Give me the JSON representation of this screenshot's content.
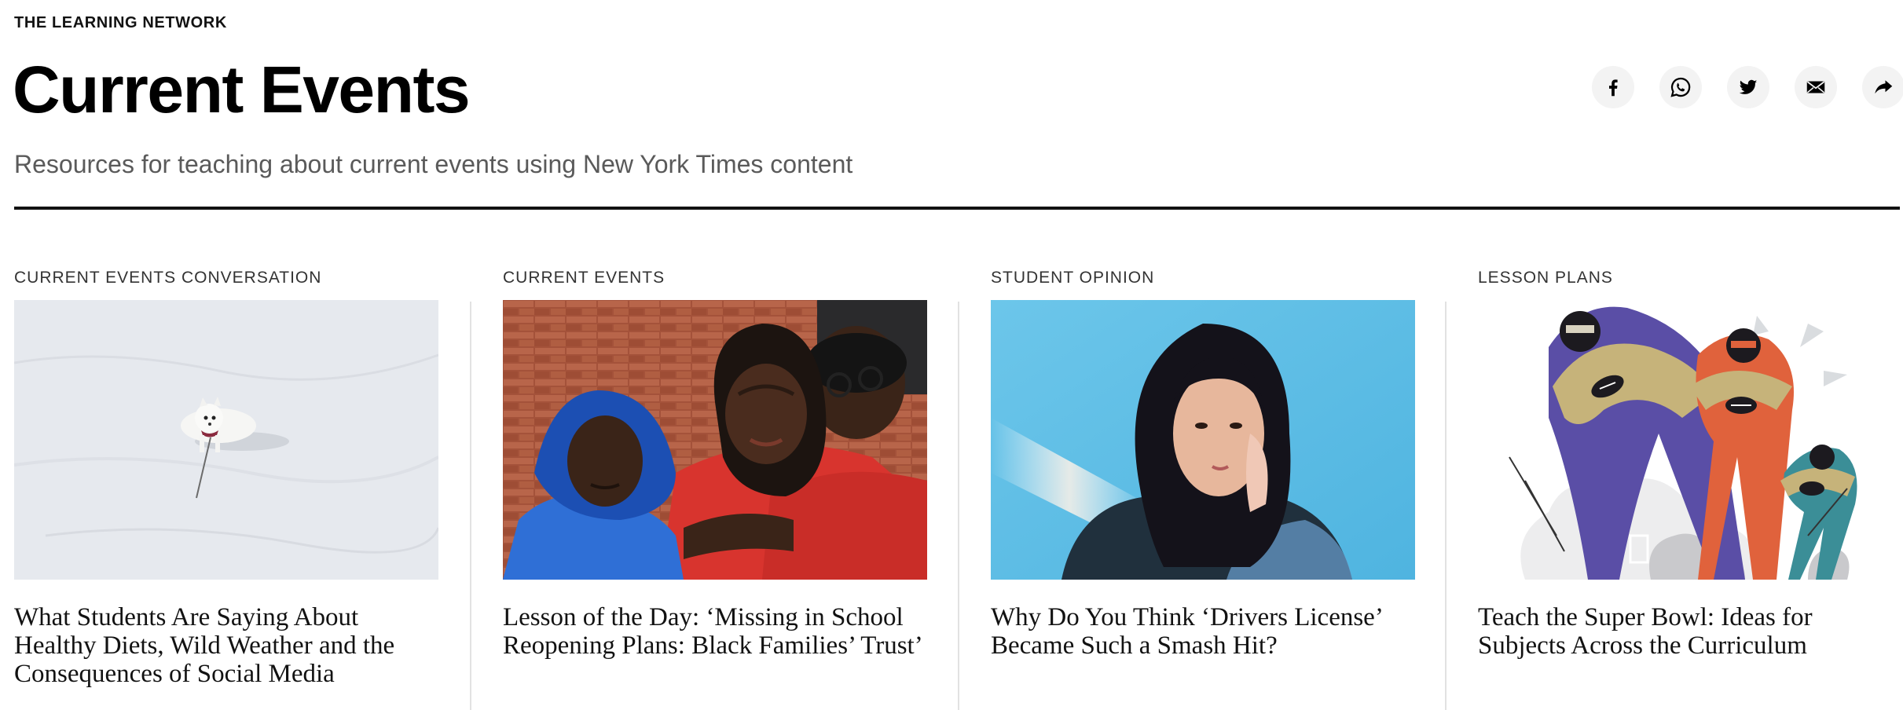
{
  "header": {
    "kicker": "THE LEARNING NETWORK",
    "title": "Current Events",
    "subtitle": "Resources for teaching about current events using New York Times content"
  },
  "share": [
    {
      "name": "facebook",
      "icon": "facebook-icon"
    },
    {
      "name": "whatsapp",
      "icon": "whatsapp-icon"
    },
    {
      "name": "twitter",
      "icon": "twitter-icon"
    },
    {
      "name": "email",
      "icon": "email-icon"
    },
    {
      "name": "share",
      "icon": "share-arrow-icon"
    }
  ],
  "cards": [
    {
      "label": "CURRENT EVENTS CONVERSATION",
      "headline": "What Students Are Saying About Healthy Diets, Wild Weather and the Consequences of Social Media",
      "image": "dog-in-snow"
    },
    {
      "label": "CURRENT EVENTS",
      "headline": "Lesson of the Day: ‘Missing in School Reopening Plans: Black Families’ Trust’",
      "image": "family-portrait"
    },
    {
      "label": "STUDENT OPINION",
      "headline": "Why Do You Think ‘Drivers License’ Became Such a Smash Hit?",
      "image": "singer-portrait"
    },
    {
      "label": "LESSON PLANS",
      "headline": "Teach the Super Bowl: Ideas for Subjects Across the Curriculum",
      "image": "football-players-illustration"
    }
  ],
  "colors": {
    "text": "#121212",
    "subtitle": "#5a5a5a",
    "icon_bg": "#f3f3f3",
    "divider": "#e2e2e2"
  }
}
